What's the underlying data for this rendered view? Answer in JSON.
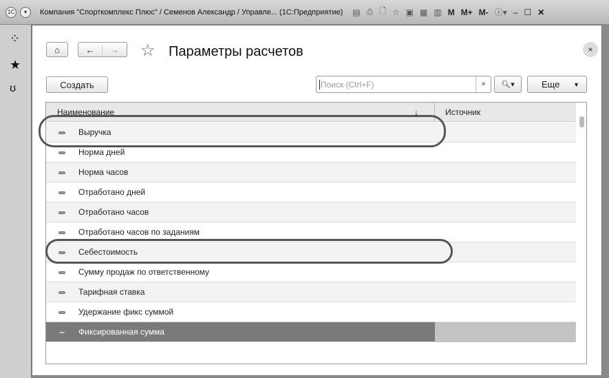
{
  "window": {
    "title": "Компания \"Спорткомплекс Плюс\" / Семенов Александр / Управле... (1С:Предприятие)",
    "m": "M",
    "mplus": "M+",
    "mminus": "M-"
  },
  "page": {
    "title": "Параметры расчетов",
    "create": "Создать",
    "search_placeholder": "Поиск (Ctrl+F)",
    "more": "Еще",
    "clear": "×",
    "close": "×"
  },
  "table": {
    "columns": [
      "Наименование",
      "Источник"
    ],
    "sort_mark": "↓",
    "rows": [
      "Выручка",
      "Норма дней",
      "Норма часов",
      "Отработано дней",
      "Отработано часов",
      "Отработано часов по заданиям",
      "Себестоимость",
      "Сумму продаж по ответственному",
      "Тарифная ставка",
      "Удержание фикс суммой",
      "Фиксированная сумма"
    ],
    "selected_index": 10,
    "highlighted": [
      0,
      6
    ]
  }
}
